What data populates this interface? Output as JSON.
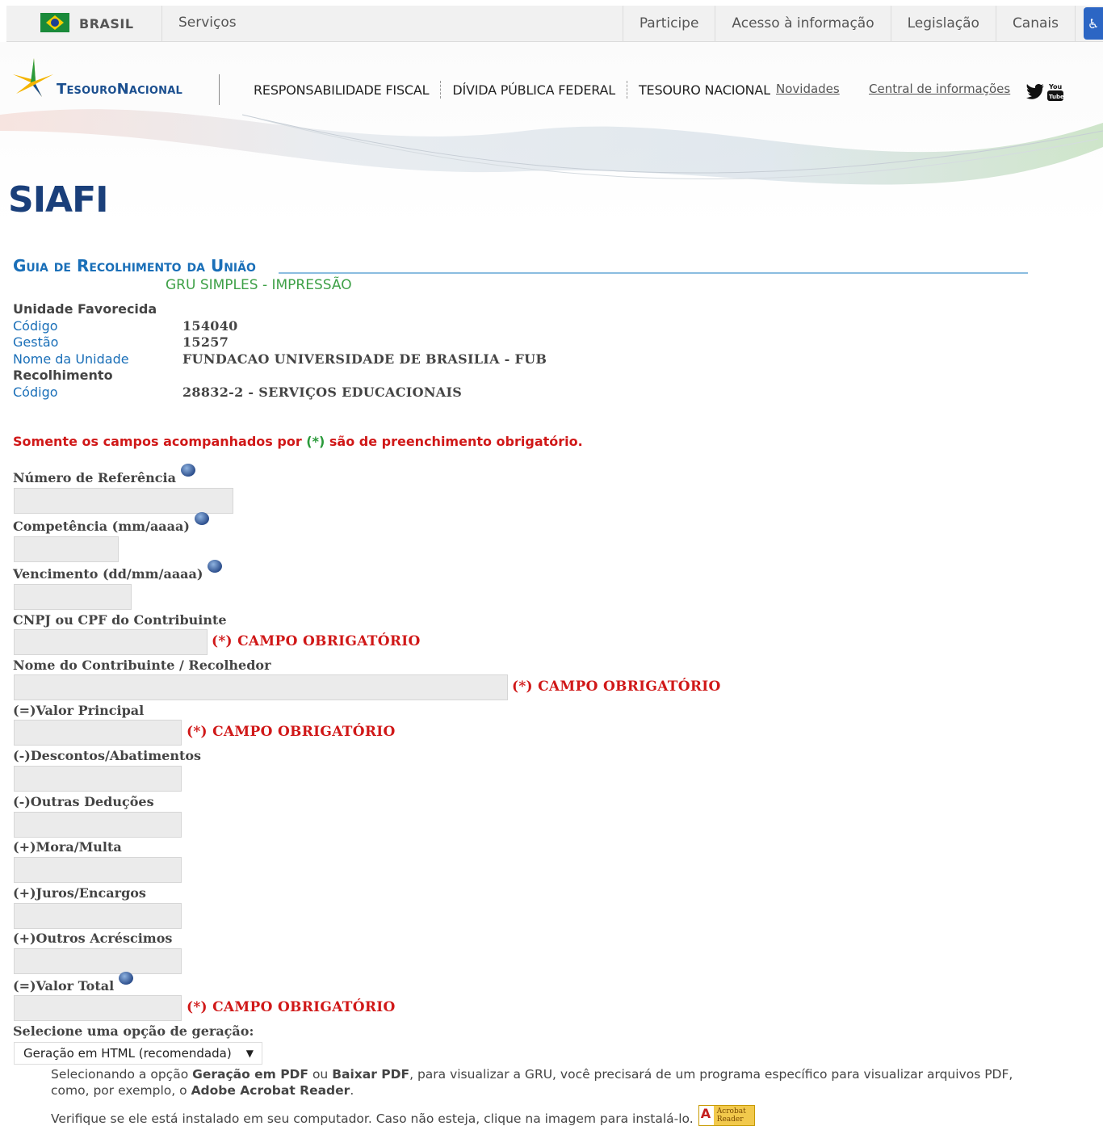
{
  "govbar": {
    "brasil": "BRASIL",
    "servicos": "Serviços",
    "links": [
      "Participe",
      "Acesso à informação",
      "Legislação",
      "Canais"
    ]
  },
  "header": {
    "logo_word1": "Tesouro",
    "logo_word2": "Nacional",
    "nav": [
      "RESPONSABILIDADE FISCAL",
      "DÍVIDA PÚBLICA FEDERAL",
      "TESOURO NACIONAL"
    ],
    "novidades": "Novidades",
    "central": "Central de informações",
    "siafi": "SIAFI"
  },
  "gru": {
    "title": "Guia de Recolhimento da União",
    "subtitle": "GRU SIMPLES - IMPRESSÃO"
  },
  "unidade": {
    "heading": "Unidade Favorecida",
    "codigo_label": "Código",
    "codigo_value": "154040",
    "gestao_label": "Gestão",
    "gestao_value": "15257",
    "nome_label": "Nome da Unidade",
    "nome_value": "FUNDACAO UNIVERSIDADE DE BRASILIA - FUB"
  },
  "recolhimento": {
    "heading": "Recolhimento",
    "codigo_label": "Código",
    "codigo_value": "28832-2 - SERVIÇOS EDUCACIONAIS"
  },
  "notice": {
    "before": "Somente os campos acompanhados por ",
    "star": "(*)",
    "after": " são de preenchimento obrigatório."
  },
  "form": {
    "numero_ref": "Número de Referência",
    "competencia": "Competência (mm/aaaa)",
    "vencimento": "Vencimento (dd/mm/aaaa)",
    "cnpj": "CNPJ ou CPF do Contribuinte",
    "nome": "Nome do Contribuinte / Recolhedor",
    "valor_principal": "(=)Valor Principal",
    "descontos": "(-)Descontos/Abatimentos",
    "outras_deducoes": "(-)Outras Deduções",
    "mora": "(+)Mora/Multa",
    "juros": "(+)Juros/Encargos",
    "outros_acrescimos": "(+)Outros Acréscimos",
    "valor_total": "(=)Valor Total",
    "required": "(*) CAMPO OBRIGATÓRIO",
    "select_label": "Selecione uma opção de geração:",
    "select_value": "Geração em HTML (recomendada)"
  },
  "help": {
    "p1_a": "Selecionando a opção ",
    "p1_b": "Geração em PDF",
    "p1_c": " ou ",
    "p1_d": "Baixar PDF",
    "p1_e": ", para visualizar a GRU, você precisará de um programa específico para visualizar arquivos PDF, como, por exemplo, o ",
    "p1_f": "Adobe Acrobat Reader",
    "p1_g": ".",
    "p2": "Verifique se ele está instalado em seu computador. Caso não esteja, clique na imagem para instalá-lo.",
    "acrobat_img_text": "Acrobat Reader"
  },
  "colors": {
    "brand_blue": "#1a3f7a",
    "link_blue": "#1a6fb8",
    "required_red": "#d01818",
    "subtitle_green": "#3ea047"
  },
  "icons": {
    "help": "help-circle-icon",
    "twitter": "twitter-icon",
    "youtube": "youtube-icon",
    "accessibility": "accessibility-icon"
  }
}
